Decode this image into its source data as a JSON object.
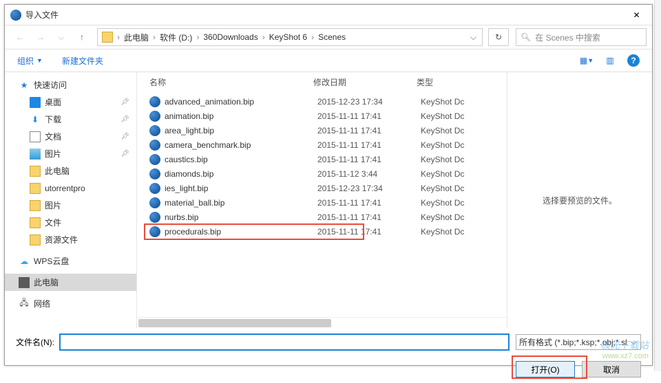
{
  "title": "导入文件",
  "breadcrumb": [
    "此电脑",
    "软件 (D:)",
    "360Downloads",
    "KeyShot 6",
    "Scenes"
  ],
  "search_placeholder": "在 Scenes 中搜索",
  "toolbar": {
    "organize": "组织",
    "newfolder": "新建文件夹"
  },
  "columns": {
    "name": "名称",
    "date": "修改日期",
    "type": "类型"
  },
  "sidebar": {
    "quick": "快速访问",
    "desktop": "桌面",
    "downloads": "下载",
    "documents": "文档",
    "pictures": "图片",
    "thispc": "此电脑",
    "utorr": "utorrentpro",
    "pictures2": "图片",
    "files": "文件",
    "resfiles": "资源文件",
    "wps": "WPS云盘",
    "thispc2": "此电脑",
    "network": "网络"
  },
  "files": [
    {
      "name": "advanced_animation.bip",
      "date": "2015-12-23 17:34",
      "type": "KeyShot Dc"
    },
    {
      "name": "animation.bip",
      "date": "2015-11-11 17:41",
      "type": "KeyShot Dc"
    },
    {
      "name": "area_light.bip",
      "date": "2015-11-11 17:41",
      "type": "KeyShot Dc"
    },
    {
      "name": "camera_benchmark.bip",
      "date": "2015-11-11 17:41",
      "type": "KeyShot Dc"
    },
    {
      "name": "caustics.bip",
      "date": "2015-11-11 17:41",
      "type": "KeyShot Dc"
    },
    {
      "name": "diamonds.bip",
      "date": "2015-11-12 3:44",
      "type": "KeyShot Dc"
    },
    {
      "name": "ies_light.bip",
      "date": "2015-12-23 17:34",
      "type": "KeyShot Dc"
    },
    {
      "name": "material_ball.bip",
      "date": "2015-11-11 17:41",
      "type": "KeyShot Dc"
    },
    {
      "name": "nurbs.bip",
      "date": "2015-11-11 17:41",
      "type": "KeyShot Dc"
    },
    {
      "name": "procedurals.bip",
      "date": "2015-11-11 17:41",
      "type": "KeyShot Dc"
    }
  ],
  "preview_empty": "选择要预览的文件。",
  "filename_label": "文件名(N):",
  "filter": "所有格式 (*.bip;*.ksp;*.obj;*.sl",
  "open_btn": "打开(O)",
  "cancel_btn": "取消",
  "watermark": {
    "line1": "极光下载站",
    "line2": "www.xz7.com"
  }
}
